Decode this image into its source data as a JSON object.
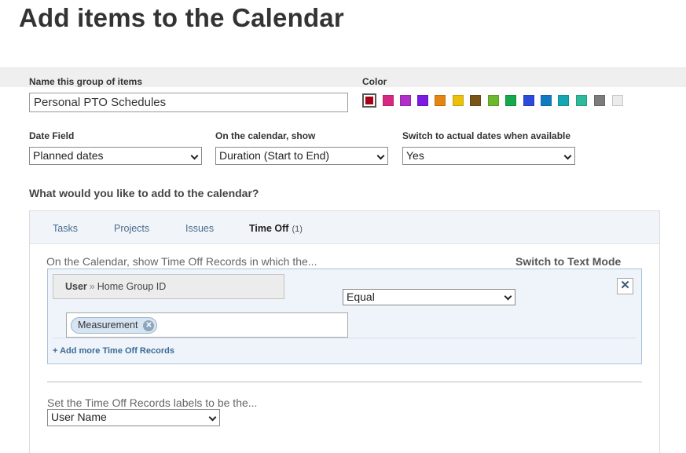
{
  "page": {
    "title": "Add items to the Calendar"
  },
  "group_name": {
    "label": "Name this group of items",
    "value": "Personal PTO Schedules"
  },
  "color": {
    "label": "Color",
    "selected_index": 0,
    "swatches": [
      "#a50016",
      "#d62783",
      "#b12ec9",
      "#7b1be0",
      "#e48512",
      "#ecc00a",
      "#7a5316",
      "#6cb82d",
      "#16a84c",
      "#2c49dc",
      "#0f7cc2",
      "#14a7b3",
      "#2db99a",
      "#7c7c7c",
      "#ebebeb"
    ]
  },
  "date_field": {
    "label": "Date Field",
    "value": "Planned dates"
  },
  "calendar_show": {
    "label": "On the calendar, show",
    "value": "Duration (Start to End)"
  },
  "switch_actual": {
    "label": "Switch to actual dates when available",
    "value": "Yes"
  },
  "add_question": "What would you like to add to the calendar?",
  "tabs": [
    {
      "label": "Tasks"
    },
    {
      "label": "Projects"
    },
    {
      "label": "Issues"
    },
    {
      "label": "Time Off",
      "count": "(1)",
      "active": true
    }
  ],
  "filter": {
    "intro": "On the Calendar, show Time Off Records in which the...",
    "switch_text_mode": "Switch to Text Mode",
    "field_entity": "User",
    "field_sep": "»",
    "field_name": "Home Group ID",
    "operator": "Equal",
    "token": "Measurement",
    "close_glyph": "✕",
    "add_more": "+ Add more Time Off Records"
  },
  "labels": {
    "intro": "Set the Time Off Records labels to be the...",
    "value": "User Name"
  }
}
